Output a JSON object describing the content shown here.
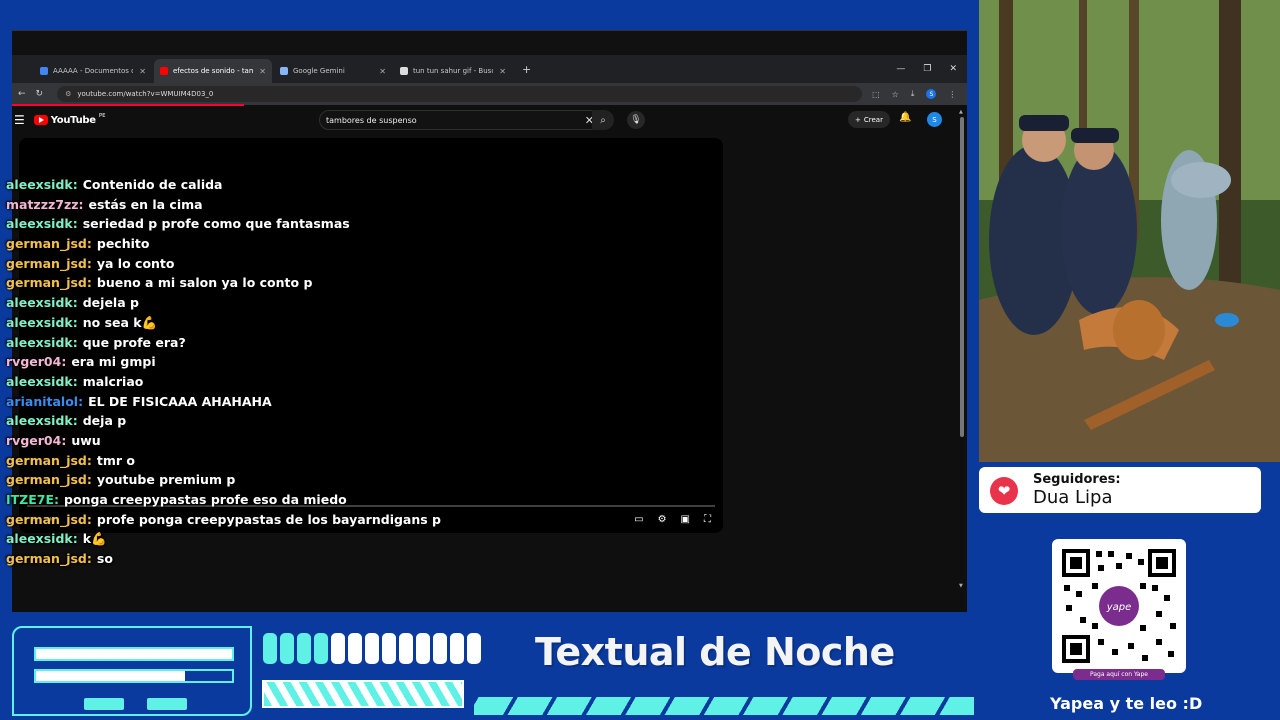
{
  "browser": {
    "tabs": [
      {
        "title": "AAAAA - Documentos de Google",
        "favicon_color": "#4285f4",
        "active": false
      },
      {
        "title": "efectos de sonido - tambores",
        "favicon_color": "#ff0000",
        "active": true
      },
      {
        "title": "Google Gemini",
        "favicon_color": "#8ab4f8",
        "active": false
      },
      {
        "title": "tun tun sahur gif - Buscar con Google",
        "favicon_color": "#dddddd",
        "active": false
      }
    ],
    "new_tab_glyph": "+",
    "url": "youtube.com/watch?v=WMUIM4D03_0"
  },
  "youtube": {
    "logo_text": "YouTube",
    "region": "PE",
    "search_query": "tambores de suspenso",
    "create_label": "Crear",
    "avatar_letter": "S"
  },
  "chat": [
    {
      "user": "aleexsidk",
      "color": "#7ff0c8",
      "text": "Contenido de calida"
    },
    {
      "user": "matzzz7zz",
      "color": "#f3b6d3",
      "text": "estás en la cima"
    },
    {
      "user": "aleexsidk",
      "color": "#7ff0c8",
      "text": "seriedad p profe como que fantasmas"
    },
    {
      "user": "german_jsd",
      "color": "#f3c04a",
      "text": "pechito"
    },
    {
      "user": "german_jsd",
      "color": "#f3c04a",
      "text": "ya lo conto"
    },
    {
      "user": "german_jsd",
      "color": "#f3c04a",
      "text": "bueno a mi salon ya lo conto p"
    },
    {
      "user": "aleexsidk",
      "color": "#7ff0c8",
      "text": "dejela p"
    },
    {
      "user": "aleexsidk",
      "color": "#7ff0c8",
      "text": "no sea k💪"
    },
    {
      "user": "aleexsidk",
      "color": "#7ff0c8",
      "text": "que profe era?"
    },
    {
      "user": "rvger04",
      "color": "#f3b6d3",
      "text": "era mi gmpi"
    },
    {
      "user": "aleexsidk",
      "color": "#7ff0c8",
      "text": "malcriao"
    },
    {
      "user": "arianitalol",
      "color": "#3a8df0",
      "text": "EL DE FISICAAA AHAHAHA"
    },
    {
      "user": "aleexsidk",
      "color": "#7ff0c8",
      "text": "deja p"
    },
    {
      "user": "rvger04",
      "color": "#f3b6d3",
      "text": "uwu"
    },
    {
      "user": "german_jsd",
      "color": "#f3c04a",
      "text": "tmr o"
    },
    {
      "user": "german_jsd",
      "color": "#f3c04a",
      "text": "youtube premium p"
    },
    {
      "user": "ITZE7E",
      "color": "#3fe6a0",
      "text": "ponga creepypastas profe eso da miedo"
    },
    {
      "user": "german_jsd",
      "color": "#f3c04a",
      "text": "profe ponga creepypastas de los bayarndigans p"
    },
    {
      "user": "aleexsidk",
      "color": "#7ff0c8",
      "text": "k💪"
    },
    {
      "user": "german_jsd",
      "color": "#f3c04a",
      "text": "so"
    }
  ],
  "followers": {
    "label": "Seguidores:",
    "name": "Dua Lipa"
  },
  "qr": {
    "brand": "yape",
    "caption": "Paga aquí con Yape",
    "cta": "Yapea y te leo :D"
  },
  "overlay": {
    "title": "Textual de Noche",
    "bar2_fill": 0.76,
    "segments": [
      {
        "color": "#5ff0e6"
      },
      {
        "color": "#5ff0e6"
      },
      {
        "color": "#5ff0e6"
      },
      {
        "color": "#5ff0e6"
      },
      {
        "color": "#ffffff"
      },
      {
        "color": "#ffffff"
      },
      {
        "color": "#ffffff"
      },
      {
        "color": "#ffffff"
      },
      {
        "color": "#ffffff"
      },
      {
        "color": "#ffffff"
      },
      {
        "color": "#ffffff"
      },
      {
        "color": "#ffffff"
      },
      {
        "color": "#ffffff"
      }
    ]
  }
}
